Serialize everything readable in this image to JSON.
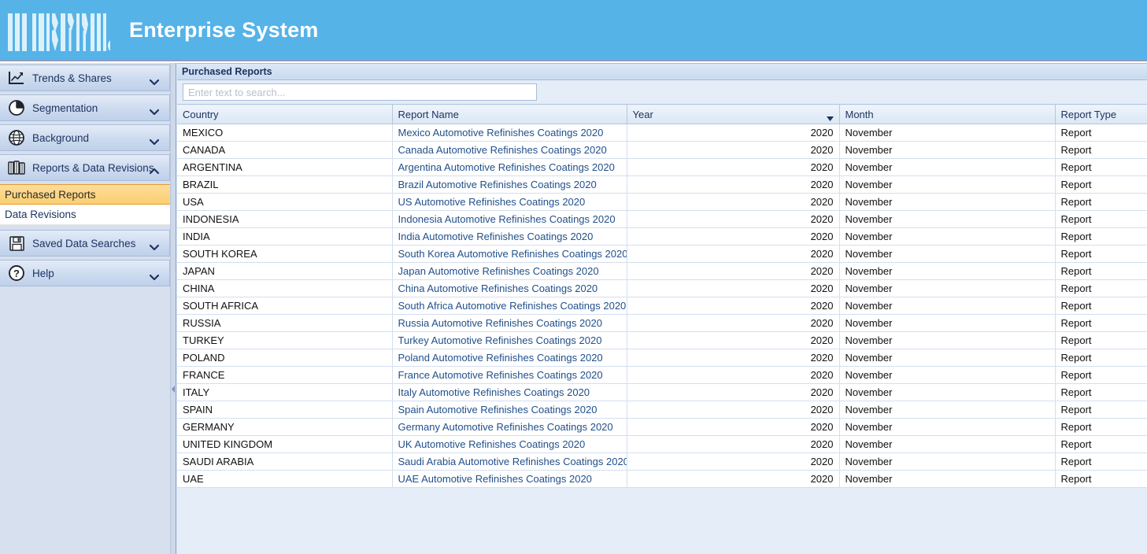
{
  "header": {
    "app_title": "Enterprise System",
    "logo_icon": "barcode-logo",
    "background_color": "#55b3e8",
    "title_color": "#ffffff"
  },
  "sidebar": {
    "groups": [
      {
        "label": "Trends & Shares",
        "icon": "line-chart-icon",
        "chevron": "chevron-down-icon",
        "expanded": false
      },
      {
        "label": "Segmentation",
        "icon": "pie-chart-icon",
        "chevron": "chevron-down-icon",
        "expanded": false
      },
      {
        "label": "Background",
        "icon": "globe-icon",
        "chevron": "chevron-down-icon",
        "expanded": false
      },
      {
        "label": "Reports & Data Revisions",
        "icon": "books-icon",
        "chevron": "chevron-up-icon",
        "expanded": true
      }
    ],
    "sub_items": [
      {
        "label": "Purchased Reports",
        "selected": true
      },
      {
        "label": "Data Revisions",
        "selected": false
      }
    ],
    "groups_after": [
      {
        "label": "Saved Data Searches",
        "icon": "floppy-disk-icon",
        "chevron": "chevron-down-icon",
        "expanded": false
      },
      {
        "label": "Help",
        "icon": "question-circle-icon",
        "chevron": "chevron-down-icon",
        "expanded": false
      }
    ],
    "selected_bg_color": "#fccf71",
    "selected_border_color": "#e59a2f"
  },
  "splitter": {
    "handle_icon": "collapse-left-arrow-icon"
  },
  "main": {
    "panel_title": "Purchased Reports",
    "search": {
      "placeholder": "Enter text to search...",
      "value": ""
    },
    "grid": {
      "columns": [
        {
          "label": "Country",
          "key": "country",
          "align": "left",
          "sorted": false
        },
        {
          "label": "Report Name",
          "key": "report_name",
          "align": "left",
          "sorted": false
        },
        {
          "label": "Year",
          "key": "year",
          "align": "right",
          "sorted": true,
          "sort_icon": "sort-descending-arrow-icon"
        },
        {
          "label": "Month",
          "key": "month",
          "align": "left",
          "sorted": false
        },
        {
          "label": "Report Type",
          "key": "report_type",
          "align": "left",
          "sorted": false
        }
      ],
      "rows": [
        {
          "country": "MEXICO",
          "report_name": "Mexico Automotive Refinishes Coatings 2020",
          "year": "2020",
          "month": "November",
          "report_type": "Report"
        },
        {
          "country": "CANADA",
          "report_name": "Canada Automotive Refinishes Coatings 2020",
          "year": "2020",
          "month": "November",
          "report_type": "Report"
        },
        {
          "country": "ARGENTINA",
          "report_name": "Argentina Automotive Refinishes Coatings 2020",
          "year": "2020",
          "month": "November",
          "report_type": "Report"
        },
        {
          "country": "BRAZIL",
          "report_name": "Brazil Automotive Refinishes Coatings 2020",
          "year": "2020",
          "month": "November",
          "report_type": "Report"
        },
        {
          "country": "USA",
          "report_name": "US Automotive Refinishes Coatings 2020",
          "year": "2020",
          "month": "November",
          "report_type": "Report"
        },
        {
          "country": "INDONESIA",
          "report_name": "Indonesia Automotive Refinishes Coatings 2020",
          "year": "2020",
          "month": "November",
          "report_type": "Report"
        },
        {
          "country": "INDIA",
          "report_name": "India Automotive Refinishes Coatings 2020",
          "year": "2020",
          "month": "November",
          "report_type": "Report"
        },
        {
          "country": "SOUTH KOREA",
          "report_name": "South Korea Automotive Refinishes Coatings 2020",
          "year": "2020",
          "month": "November",
          "report_type": "Report"
        },
        {
          "country": "JAPAN",
          "report_name": "Japan Automotive Refinishes Coatings 2020",
          "year": "2020",
          "month": "November",
          "report_type": "Report"
        },
        {
          "country": "CHINA",
          "report_name": "China Automotive Refinishes Coatings 2020",
          "year": "2020",
          "month": "November",
          "report_type": "Report"
        },
        {
          "country": "SOUTH AFRICA",
          "report_name": "South Africa Automotive Refinishes Coatings 2020",
          "year": "2020",
          "month": "November",
          "report_type": "Report"
        },
        {
          "country": "RUSSIA",
          "report_name": "Russia Automotive Refinishes Coatings 2020",
          "year": "2020",
          "month": "November",
          "report_type": "Report"
        },
        {
          "country": "TURKEY",
          "report_name": "Turkey Automotive Refinishes Coatings 2020",
          "year": "2020",
          "month": "November",
          "report_type": "Report"
        },
        {
          "country": "POLAND",
          "report_name": "Poland Automotive Refinishes Coatings 2020",
          "year": "2020",
          "month": "November",
          "report_type": "Report"
        },
        {
          "country": "FRANCE",
          "report_name": "France Automotive Refinishes Coatings 2020",
          "year": "2020",
          "month": "November",
          "report_type": "Report"
        },
        {
          "country": "ITALY",
          "report_name": "Italy Automotive Refinishes Coatings 2020",
          "year": "2020",
          "month": "November",
          "report_type": "Report"
        },
        {
          "country": "SPAIN",
          "report_name": "Spain Automotive Refinishes Coatings 2020",
          "year": "2020",
          "month": "November",
          "report_type": "Report"
        },
        {
          "country": "GERMANY",
          "report_name": "Germany Automotive Refinishes Coatings 2020",
          "year": "2020",
          "month": "November",
          "report_type": "Report"
        },
        {
          "country": "UNITED KINGDOM",
          "report_name": "UK Automotive Refinishes Coatings 2020",
          "year": "2020",
          "month": "November",
          "report_type": "Report"
        },
        {
          "country": "SAUDI ARABIA",
          "report_name": "Saudi Arabia Automotive Refinishes Coatings 2020",
          "year": "2020",
          "month": "November",
          "report_type": "Report"
        },
        {
          "country": "UAE",
          "report_name": "UAE Automotive Refinishes Coatings 2020",
          "year": "2020",
          "month": "November",
          "report_type": "Report"
        }
      ]
    }
  }
}
